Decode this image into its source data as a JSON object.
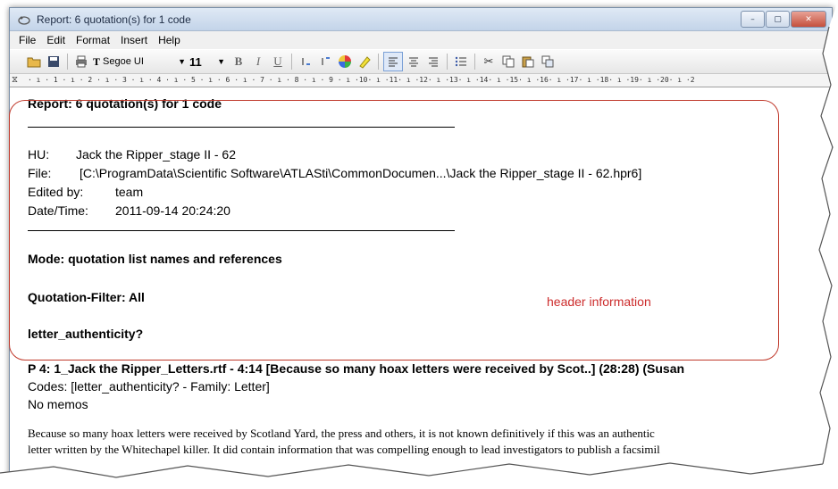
{
  "window": {
    "title": "Report: 6 quotation(s) for 1 code",
    "buttons": {
      "minimize": "–",
      "maximize": "▢",
      "close": "✕"
    }
  },
  "menu": [
    "File",
    "Edit",
    "Format",
    "Insert",
    "Help"
  ],
  "toolbar": {
    "font_glyph": "T",
    "font_name": "Segoe UI",
    "font_size": "11",
    "bold": "B",
    "italic": "I",
    "underline": "U"
  },
  "ruler": {
    "text": "· ı · 1 · ı · 2 · ı · 3 · ı · 4 · ı · 5 · ı · 6 · ı · 7 · ı · 8 · ı · 9 · ı ·10· ı ·11· ı ·12· ı ·13· ı ·14· ı ·15· ı ·16· ı ·17· ı ·18· ı ·19· ı ·20· ı ·2"
  },
  "report": {
    "title": "Report: 6 quotation(s) for 1 code",
    "hu_label": "HU:",
    "hu_value": "Jack the Ripper_stage II - 62",
    "file_label": "File:",
    "file_value": "[C:\\ProgramData\\Scientific Software\\ATLASti\\CommonDocumen...\\Jack the Ripper_stage II - 62.hpr6]",
    "edited_label": "Edited by:",
    "edited_value": "team",
    "datetime_label": "Date/Time:",
    "datetime_value": "2011-09-14 20:24:20",
    "mode": "Mode: quotation list names and references",
    "filter": "Quotation-Filter: All",
    "code": "letter_authenticity?",
    "quote_heading": "P 4: 1_Jack the Ripper_Letters.rtf - 4:14 [Because so many hoax letters were received by Scot..]  (28:28)   (Susan",
    "codes_line": "Codes: [letter_authenticity? - Family: Letter]",
    "memos_line": "No memos",
    "body_line1": "Because so many hoax  letters were received by Scotland Yard, the press and others, it is not known definitively if this was an authentic",
    "body_line2": "letter written by the Whitechapel killer. It did contain information that was compelling enough to lead investigators to publish a facsimil"
  },
  "annotation": {
    "label": "header information",
    "color": "#c0392b"
  }
}
